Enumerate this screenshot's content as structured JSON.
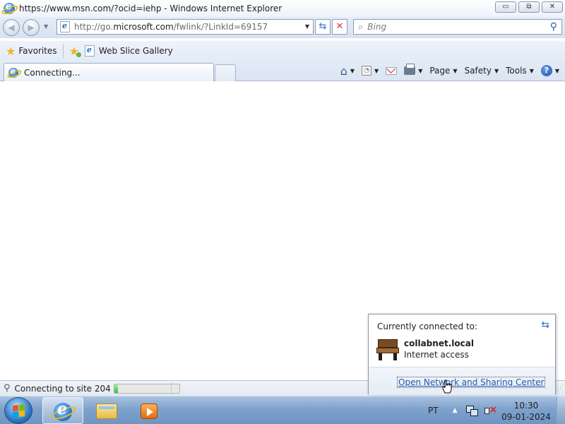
{
  "window": {
    "title": "https://www.msn.com/?ocid=iehp - Windows Internet Explorer",
    "buttons": {
      "minimize": "▭",
      "maximize": "⧉",
      "close": "✕"
    }
  },
  "navigation": {
    "back_icon": "back-arrow-icon",
    "forward_icon": "forward-arrow-icon",
    "address": {
      "prefix": "http://go.",
      "domain": "microsoft.com",
      "path": "/fwlink/?LinkId=69157"
    },
    "search": {
      "placeholder": "Bing"
    }
  },
  "favorites_bar": {
    "favorites_label": "Favorites",
    "items": [
      {
        "label": "Web Slice Gallery",
        "icon": "ie-page-icon"
      }
    ]
  },
  "tabs": [
    {
      "label": "Connecting...",
      "active": true
    }
  ],
  "command_bar": {
    "items": [
      {
        "icon": "home-icon"
      },
      {
        "icon": "feed-icon"
      },
      {
        "icon": "read-mail-icon"
      },
      {
        "icon": "print-icon"
      },
      {
        "label": "Page"
      },
      {
        "label": "Safety"
      },
      {
        "label": "Tools"
      },
      {
        "icon": "help-icon"
      }
    ]
  },
  "status_bar": {
    "text": "Connecting to site 204",
    "progress": 0.06
  },
  "network_popup": {
    "title": "Currently connected to:",
    "network_name": "collabnet.local",
    "network_status": "Internet access",
    "link": "Open Network and Sharing Center"
  },
  "taskbar": {
    "pinned": [
      "internet-explorer",
      "windows-explorer",
      "windows-media-player"
    ],
    "language": "PT",
    "time": "10:30",
    "date": "09-01-2024"
  }
}
